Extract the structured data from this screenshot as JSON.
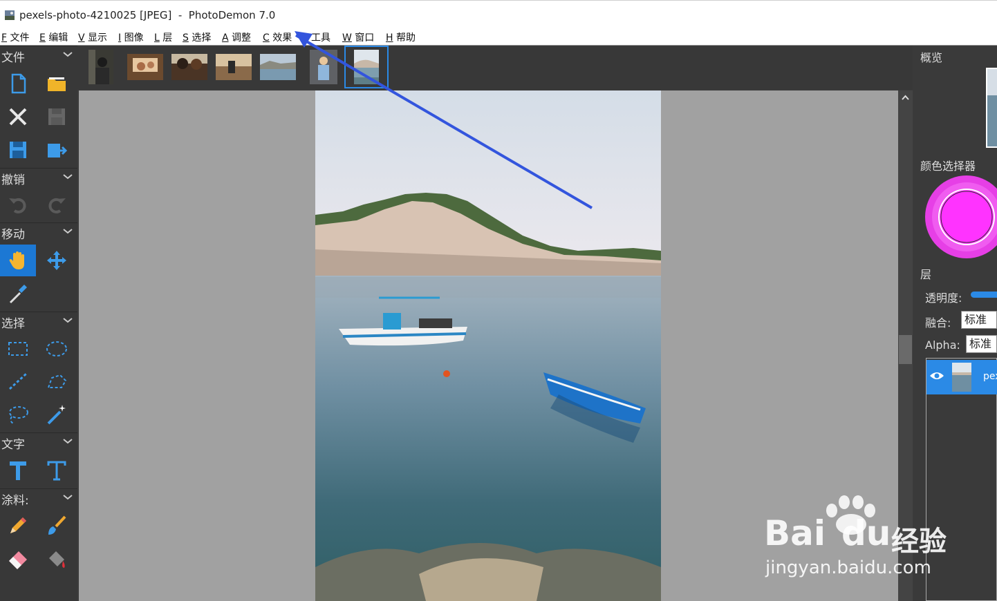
{
  "window": {
    "title": "pexels-photo-4210025 [JPEG]  -  PhotoDemon 7.0"
  },
  "menu": [
    {
      "key": "F",
      "label": "文件"
    },
    {
      "key": "E",
      "label": "编辑"
    },
    {
      "key": "V",
      "label": "显示"
    },
    {
      "key": "I",
      "label": "图像"
    },
    {
      "key": "L",
      "label": "层"
    },
    {
      "key": "S",
      "label": "选择"
    },
    {
      "key": "A",
      "label": "调整"
    },
    {
      "key": "C",
      "label": "效果"
    },
    {
      "key": "T",
      "label": "工具"
    },
    {
      "key": "W",
      "label": "窗口"
    },
    {
      "key": "H",
      "label": "帮助"
    }
  ],
  "toolbox": {
    "file": "文件",
    "undo": "撤销",
    "move": "移动",
    "select": "选择",
    "text": "文字",
    "paint": "涂料:"
  },
  "right_panel": {
    "overview": "概览",
    "color_picker": "颜色选择器",
    "color": "#ff33ff",
    "layers": "层",
    "opacity_label": "透明度:",
    "blend_label": "融合:",
    "blend_value": "标准",
    "alpha_label": "Alpha:",
    "alpha_value": "标准",
    "layer_name": "pex"
  },
  "watermark": {
    "brand": "Bai",
    "brand2": "du",
    "cn": "经验",
    "url": "jingyan.baidu.com"
  }
}
